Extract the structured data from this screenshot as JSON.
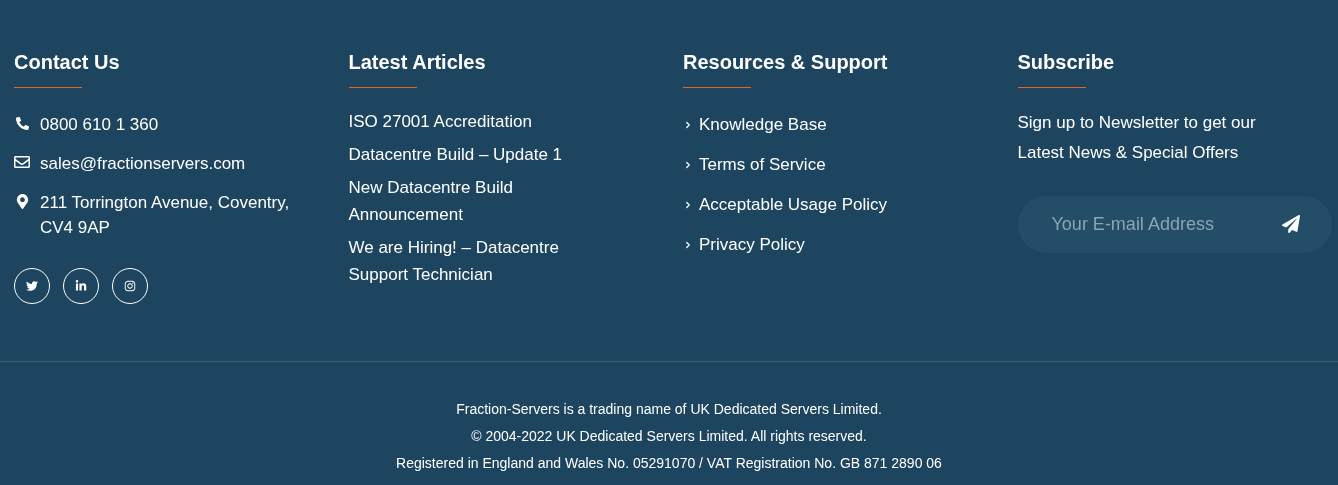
{
  "contact": {
    "title": "Contact Us",
    "items": [
      {
        "kind": "phone",
        "lines": [
          "0800 610 1 360"
        ]
      },
      {
        "kind": "email",
        "lines": [
          "sales@fractionservers.com"
        ]
      },
      {
        "kind": "location",
        "lines": [
          "211 Torrington Avenue, Coventry,",
          "CV4 9AP"
        ]
      }
    ],
    "social": [
      {
        "kind": "twitter"
      },
      {
        "kind": "linkedin"
      },
      {
        "kind": "instagram"
      }
    ]
  },
  "articles": {
    "title": "Latest Articles",
    "items": [
      "ISO 27001 Accreditation",
      "Datacentre Build – Update 1",
      "New Datacentre Build Announcement",
      "We are Hiring! – Datacentre Support Technician"
    ]
  },
  "resources": {
    "title": "Resources & Support",
    "items": [
      "Knowledge Base",
      "Terms of Service",
      "Acceptable Usage Policy",
      "Privacy Policy"
    ]
  },
  "subscribe": {
    "title": "Subscribe",
    "text": "Sign up to Newsletter to get our Latest News & Special Offers",
    "placeholder": "Your E-mail Address"
  },
  "bottom": [
    "Fraction-Servers is a trading name of UK Dedicated Servers Limited.",
    "© 2004-2022 UK Dedicated Servers Limited. All rights reserved.",
    "Registered in England and Wales No. 05291070 / VAT Registration No. GB 871 2890 06"
  ]
}
